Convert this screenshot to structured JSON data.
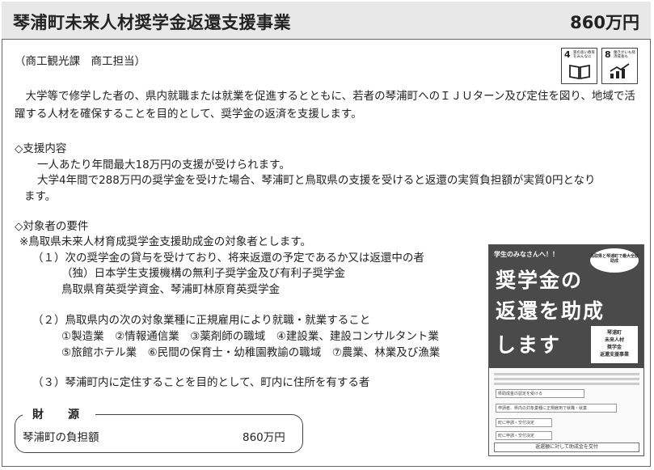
{
  "header": {
    "title": "琴浦町未来人材奨学金返還支援事業",
    "amount": "860万円"
  },
  "dept": "（商工観光課　商工担当）",
  "sdgs": [
    {
      "number": "4",
      "caption": "質の高い教育をみんなに",
      "icon": "book-icon"
    },
    {
      "number": "8",
      "caption": "働きがいも経済成長も",
      "icon": "growth-chart-icon"
    }
  ],
  "intro": "　大学等で修学した者の、県内就職または就業を促進するとともに、若者の琴浦町へのＩＪＵターン及び定住を図り、地域で活躍する人材を確保することを目的として、奨学金の返済を支援します。",
  "support": {
    "heading": "◇支援内容",
    "line1": "一人あたり年間最大18万円の支援が受けられます。",
    "line2": "大学4年間で288万円の奨学金を受けた場合、琴浦町と鳥取県の支援を受けると返還の実質負担額が実質0円となり",
    "line2b": "ます。"
  },
  "requirements": {
    "heading": "◇対象者の要件",
    "note": "※鳥取県未来人材育成奨学金支援助成金の対象者とします。",
    "items": [
      {
        "text": "（１）次の奨学金の貸与を受けており、将来返還の予定であるか又は返還中の者",
        "sub": [
          "（独）日本学生支援機構の無利子奨学金及び有利子奨学金",
          "鳥取県育英奨学資金、琴浦町林原育英奨学金"
        ]
      },
      {
        "text": "（２）鳥取県内の次の対象業種に正規雇用により就職・就業すること",
        "sub": [
          "①製造業　②情報通信業　③薬剤師の職域　④建設業、建設コンサルタント業",
          "⑤旅館ホテル業　⑥民間の保育士・幼稚園教諭の職域　⑦農業、林業及び漁業"
        ]
      },
      {
        "text": "（３）琴浦町内に定住することを目的として、町内に住所を有する者",
        "sub": []
      }
    ]
  },
  "funding": {
    "title": "財　源",
    "label": "琴浦町の負担額",
    "value": "860万円"
  },
  "poster": {
    "head": "学生のみなさんへ！！",
    "badge": "鳥取県と琴浦町で最大全額助成",
    "big1": "奨学金の",
    "big2": "返還を助成",
    "big3": "します",
    "vbox": [
      "琴浦町",
      "未来人材",
      "奨学金",
      "返還支援事業"
    ],
    "flow": [
      "県助成金の認定を受ける",
      "申請者、県内の対象業種に正規雇用で就職・就業",
      "町に申請・交付決定",
      "町に申請・交付決定"
    ],
    "bottom": "返還額に対して助成金を交付"
  }
}
